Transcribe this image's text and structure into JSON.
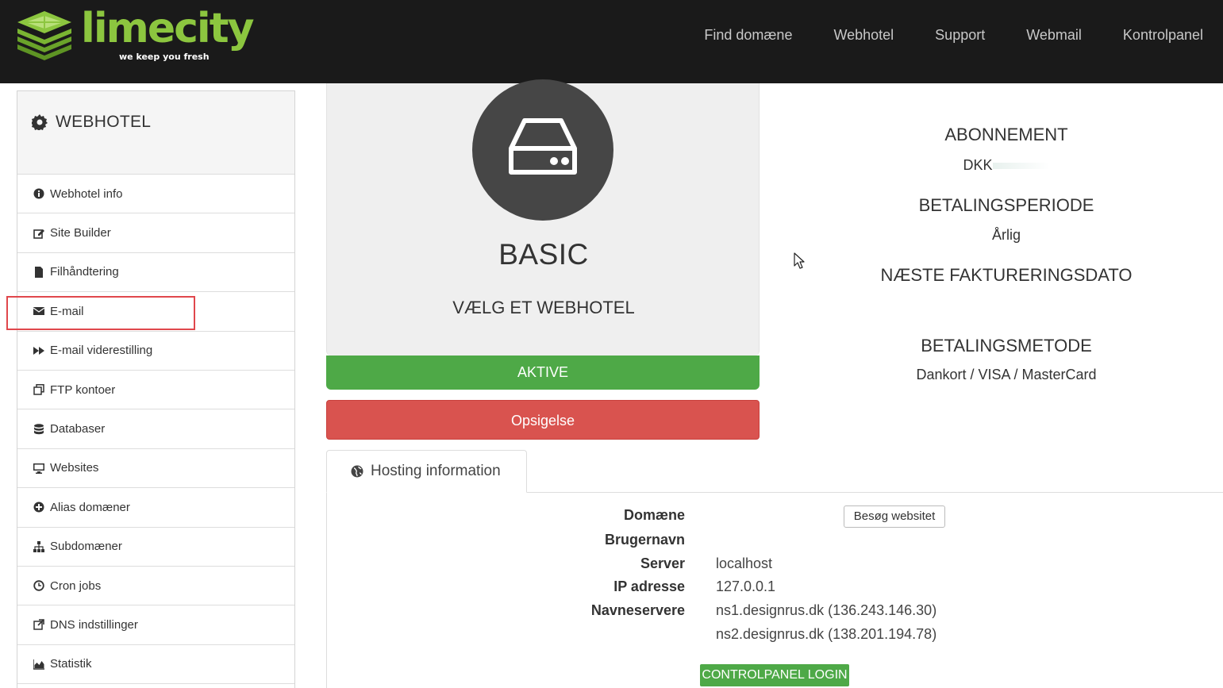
{
  "brand": {
    "name": "limecity",
    "tagline": "we keep you fresh",
    "colors": {
      "accent": "#8cc63f",
      "header_bg": "#1a1a1a",
      "success": "#4ea947",
      "danger": "#d9534f"
    }
  },
  "nav": {
    "items": [
      {
        "label": "Find domæne"
      },
      {
        "label": "Webhotel"
      },
      {
        "label": "Support"
      },
      {
        "label": "Webmail"
      },
      {
        "label": "Kontrolpanel"
      }
    ]
  },
  "sidebar": {
    "title": "WEBHOTEL",
    "title_icon": "gear-icon",
    "items": [
      {
        "label": "Webhotel info",
        "icon": "info-circle-icon"
      },
      {
        "label": "Site Builder",
        "icon": "edit-icon"
      },
      {
        "label": "Filhåndtering",
        "icon": "file-icon"
      },
      {
        "label": "E-mail",
        "icon": "envelope-icon",
        "highlighted": true
      },
      {
        "label": "E-mail viderestilling",
        "icon": "forward-icon"
      },
      {
        "label": "FTP kontoer",
        "icon": "copy-icon"
      },
      {
        "label": "Databaser",
        "icon": "database-icon"
      },
      {
        "label": "Websites",
        "icon": "desktop-icon"
      },
      {
        "label": "Alias domæner",
        "icon": "plus-circle-icon"
      },
      {
        "label": "Subdomæner",
        "icon": "sitemap-icon"
      },
      {
        "label": "Cron jobs",
        "icon": "clock-icon"
      },
      {
        "label": "DNS indstillinger",
        "icon": "external-link-icon"
      },
      {
        "label": "Statistik",
        "icon": "area-chart-icon"
      }
    ]
  },
  "plan": {
    "icon": "hard-drive-icon",
    "name": "BASIC",
    "subtitle": "VÆLG ET WEBHOTEL",
    "status": "AKTIVE",
    "cancel_label": "Opsigelse"
  },
  "billing": {
    "subscription_label": "ABONNEMENT",
    "subscription_value": "DKK",
    "period_label": "BETALINGSPERIODE",
    "period_value": "Årlig",
    "next_date_label": "NÆSTE FAKTURERINGSDATO",
    "method_label": "BETALINGSMETODE",
    "method_value": "Dankort / VISA / MasterCard"
  },
  "hosting": {
    "tab_label": "Hosting information",
    "tab_icon": "globe-icon",
    "domain_label": "Domæne",
    "visit_label": "Besøg websitet",
    "username_label": "Brugernavn",
    "server_label": "Server",
    "server_value": "localhost",
    "ip_label": "IP adresse",
    "ip_value": "127.0.0.1",
    "ns_label": "Navneservere",
    "ns1": "ns1.designrus.dk (136.243.146.30)",
    "ns2": "ns2.designrus.dk (138.201.194.78)",
    "cp_login_label": "CONTROLPANEL LOGIN"
  }
}
